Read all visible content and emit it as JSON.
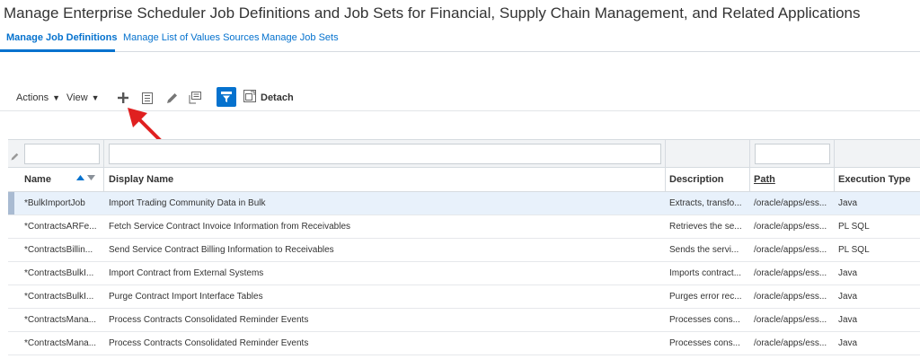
{
  "page": {
    "title": "Manage Enterprise Scheduler Job Definitions and Job Sets for Financial, Supply Chain Management, and Related Applications"
  },
  "tabs": [
    {
      "label": "Manage Job Definitions",
      "active": true
    },
    {
      "label": "Manage List of Values Sources",
      "active": false
    },
    {
      "label": "Manage Job Sets",
      "active": false
    }
  ],
  "toolbar": {
    "actions_label": "Actions",
    "view_label": "View",
    "detach_label": "Detach",
    "icons": [
      "add-icon",
      "view-icon",
      "edit-icon",
      "duplicate-icon",
      "query-by-example-icon",
      "detach-icon"
    ]
  },
  "table": {
    "columns": [
      "Name",
      "Display Name",
      "Description",
      "Path",
      "Execution Type"
    ],
    "sorted_column": "Name",
    "rows": [
      {
        "name": "*BulkImportJob",
        "display_name": "Import Trading Community Data in Bulk",
        "description": "Extracts, transfo...",
        "path": "/oracle/apps/ess...",
        "execution_type": "Java",
        "selected": true
      },
      {
        "name": "*ContractsARFe...",
        "display_name": "Fetch Service Contract Invoice Information from Receivables",
        "description": "Retrieves the se...",
        "path": "/oracle/apps/ess...",
        "execution_type": "PL SQL",
        "selected": false
      },
      {
        "name": "*ContractsBillin...",
        "display_name": "Send Service Contract Billing Information to Receivables",
        "description": "Sends the servi...",
        "path": "/oracle/apps/ess...",
        "execution_type": "PL SQL",
        "selected": false
      },
      {
        "name": "*ContractsBulkI...",
        "display_name": "Import Contract from External Systems",
        "description": "Imports contract...",
        "path": "/oracle/apps/ess...",
        "execution_type": "Java",
        "selected": false
      },
      {
        "name": "*ContractsBulkI...",
        "display_name": "Purge Contract Import Interface Tables",
        "description": "Purges error rec...",
        "path": "/oracle/apps/ess...",
        "execution_type": "Java",
        "selected": false
      },
      {
        "name": "*ContractsMana...",
        "display_name": "Process Contracts Consolidated Reminder Events",
        "description": "Processes cons...",
        "path": "/oracle/apps/ess...",
        "execution_type": "Java",
        "selected": false
      },
      {
        "name": "*ContractsMana...",
        "display_name": "Process Contracts Consolidated Reminder Events",
        "description": "Processes cons...",
        "path": "/oracle/apps/ess...",
        "execution_type": "Java",
        "selected": false
      }
    ]
  },
  "colors": {
    "accent": "#0572ce",
    "annotation_arrow": "#e02020",
    "selected_row": "#e8f1fb"
  }
}
